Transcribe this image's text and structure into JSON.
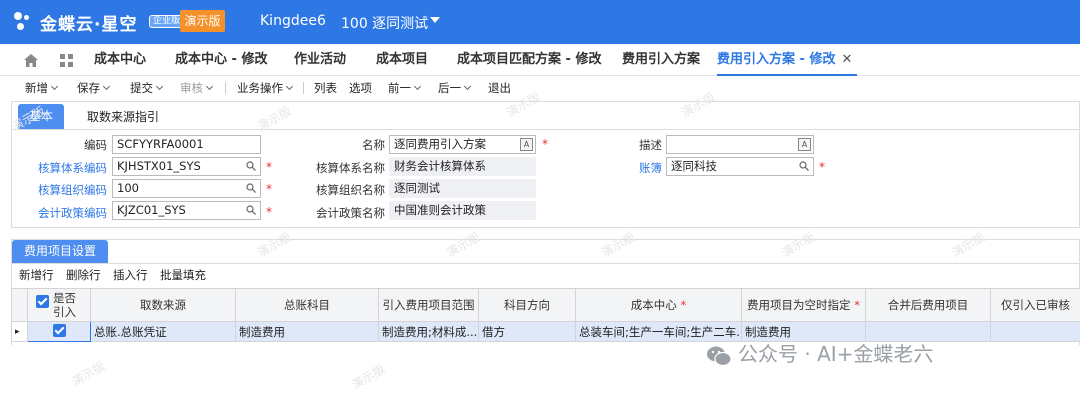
{
  "topbar": {
    "brand": "金蝶云·星空",
    "edition": "企业版",
    "demo_badge": "演示版",
    "tenant": "Kingdee6",
    "org": "100  逐同测试",
    "color": "#2e78e6"
  },
  "tabs": [
    {
      "label": "成本中心"
    },
    {
      "label": "成本中心 - 修改"
    },
    {
      "label": "作业活动"
    },
    {
      "label": "成本项目"
    },
    {
      "label": "成本项目匹配方案 - 修改"
    },
    {
      "label": "费用引入方案"
    },
    {
      "label": "费用引入方案 - 修改",
      "close": "✕"
    }
  ],
  "toolbar": [
    {
      "label": "新增"
    },
    {
      "label": "保存"
    },
    {
      "label": "提交"
    },
    {
      "label": "审核"
    },
    {
      "label": "业务操作"
    },
    {
      "label": "列表"
    },
    {
      "label": "选项"
    },
    {
      "label": "前一"
    },
    {
      "label": "后一"
    },
    {
      "label": "退出"
    }
  ],
  "basic": {
    "tab_basic": "基本",
    "tab_source": "取数来源指引",
    "code_label": "编码",
    "code_value": "SCFYYRFA0001",
    "name_label": "名称",
    "name_value": "逐同费用引入方案",
    "desc_label": "描述",
    "desc_value": "",
    "acct_sys_code_label": "核算体系编码",
    "acct_sys_code_value": "KJHSTX01_SYS",
    "acct_sys_name_label": "核算体系名称",
    "acct_sys_name_value": "财务会计核算体系",
    "book_label": "账簿",
    "book_value": "逐同科技",
    "acct_org_code_label": "核算组织编码",
    "acct_org_code_value": "100",
    "acct_org_name_label": "核算组织名称",
    "acct_org_name_value": "逐同测试",
    "policy_code_label": "会计政策编码",
    "policy_code_value": "KJZC01_SYS",
    "policy_name_label": "会计政策名称",
    "policy_name_value": "中国准则会计政策",
    "a_glyph": "A",
    "required": "*"
  },
  "expense": {
    "tab": "费用项目设置",
    "actions": [
      "新增行",
      "删除行",
      "插入行",
      "批量填充"
    ],
    "columns": [
      "是否引入",
      "取数来源",
      "总账科目",
      "引入费用项目范围",
      "科目方向",
      "成本中心",
      "费用项目为空时指定",
      "合并后费用项目",
      "仅引入已审核"
    ],
    "col_required": "*",
    "rows": [
      {
        "marker": "▸",
        "source": "总账.总账凭证",
        "gl_account": "制造费用",
        "scope": "制造费用;材料成...",
        "direction": "借方",
        "cost_center": "总装车间;生产一车间;生产二车...",
        "default_item": "制造费用",
        "merged_item": "",
        "audited_only": ""
      }
    ]
  },
  "watermark_text": "演示版",
  "footer_watermark": "公众号 · AI+金蝶老六"
}
